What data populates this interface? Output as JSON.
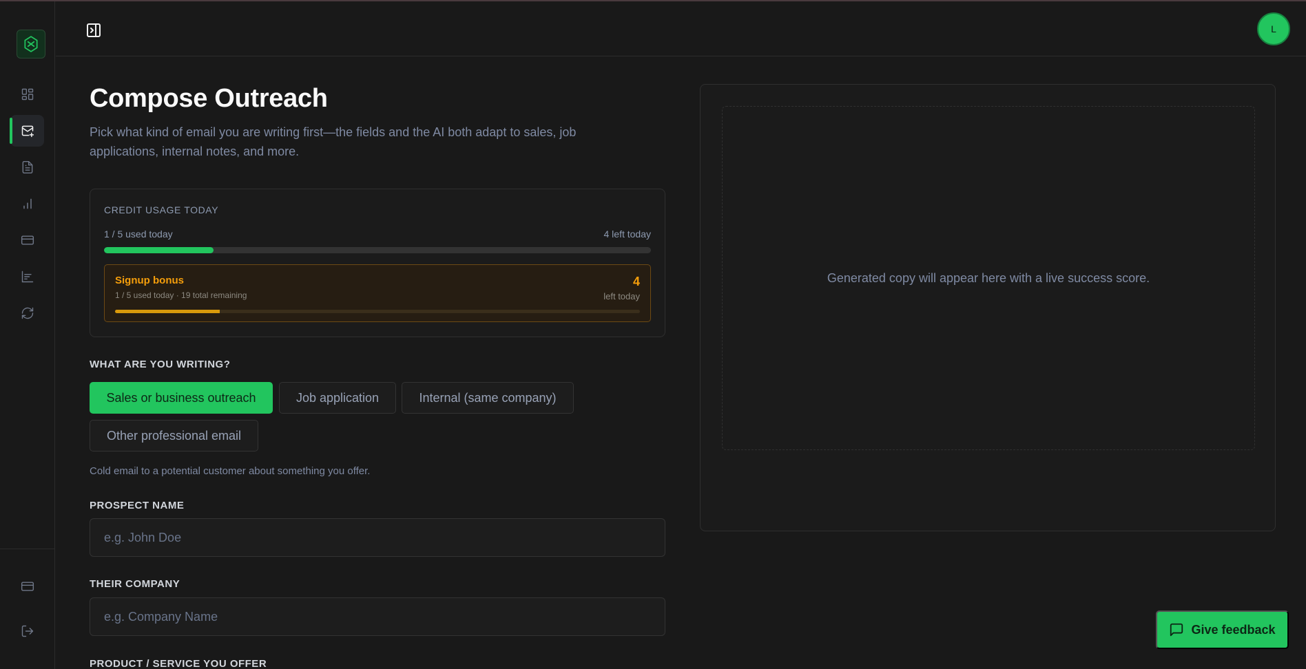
{
  "header": {
    "avatar_initial": "L"
  },
  "page": {
    "title": "Compose Outreach",
    "subtitle": "Pick what kind of email you are writing first—the fields and the AI both adapt to sales, job applications, internal notes, and more."
  },
  "credit": {
    "title": "CREDIT USAGE TODAY",
    "used_text": "1 / 5 used today",
    "left_text": "4 left today",
    "used_fraction": 0.2,
    "bonus": {
      "title": "Signup bonus",
      "subtitle": "1 / 5 used today · 19 total remaining",
      "number": "4",
      "left_label": "left today",
      "used_fraction": 0.2
    }
  },
  "writing": {
    "label": "WHAT ARE YOU WRITING?",
    "options": [
      "Sales or business outreach",
      "Job application",
      "Internal (same company)",
      "Other professional email"
    ],
    "selected": "Sales or business outreach",
    "hint": "Cold email to a potential customer about something you offer."
  },
  "form": {
    "prospect_label": "PROSPECT NAME",
    "prospect_placeholder": "e.g. John Doe",
    "company_label": "THEIR COMPANY",
    "company_placeholder": "e.g. Company Name",
    "product_label": "PRODUCT / SERVICE YOU OFFER"
  },
  "preview": {
    "placeholder": "Generated copy will appear here with a live success score."
  },
  "feedback": {
    "label": "Give feedback"
  },
  "colors": {
    "accent": "#22c55e",
    "bonus": "#f59e0b",
    "background": "#191919"
  },
  "icons": {
    "sidebar": [
      "dashboard-icon",
      "mail-compose-icon",
      "document-icon",
      "bar-chart-icon",
      "credit-card-icon",
      "analytics-icon",
      "refresh-icon"
    ],
    "sidebar_bottom": [
      "billing-icon",
      "logout-icon"
    ]
  }
}
